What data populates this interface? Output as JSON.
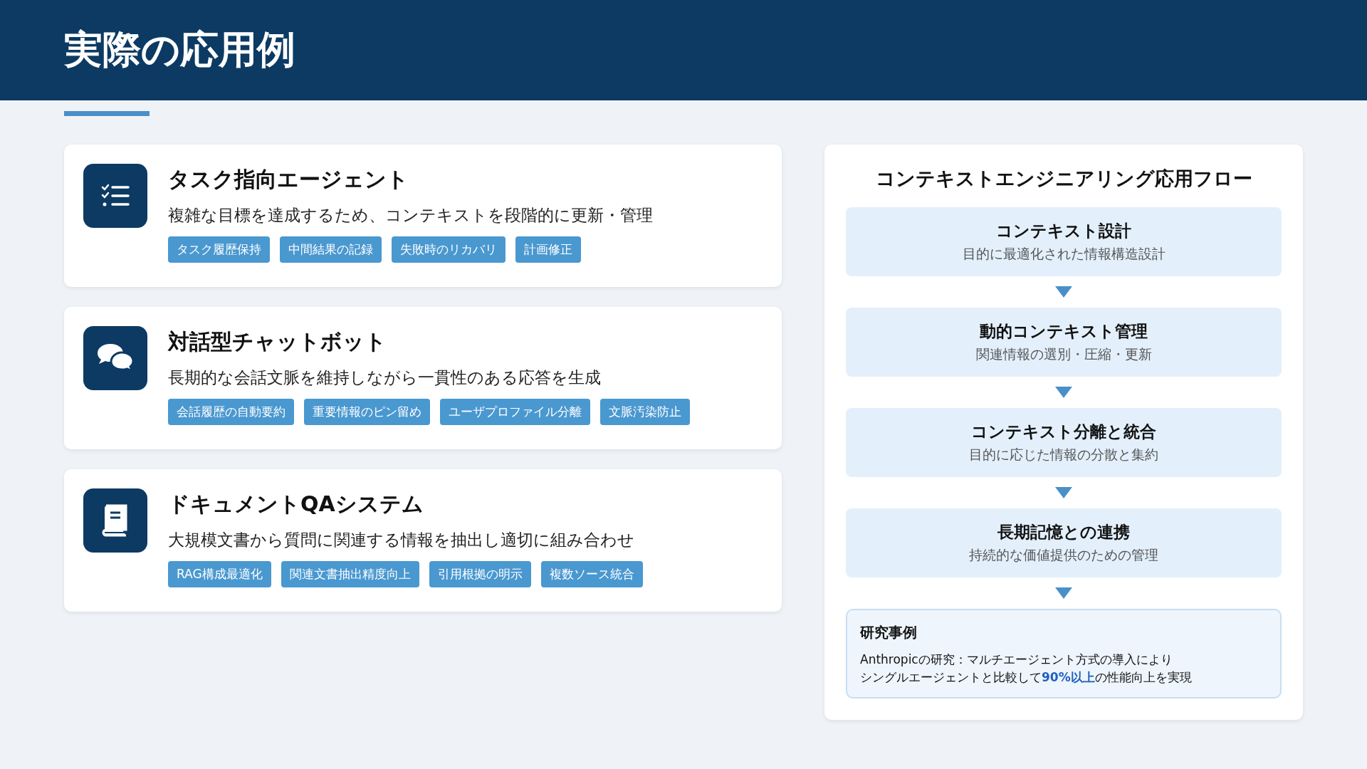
{
  "header": {
    "title": "実際の応用例"
  },
  "cards": [
    {
      "kind": "checklist",
      "title": "タスク指向エージェント",
      "description": "複雑な目標を達成するため、コンテキストを段階的に更新・管理",
      "tags": [
        "タスク履歴保持",
        "中間結果の記録",
        "失敗時のリカバリ",
        "計画修正"
      ]
    },
    {
      "kind": "chat",
      "title": "対話型チャットボット",
      "description": "長期的な会話文脈を維持しながら一貫性のある応答を生成",
      "tags": [
        "会話履歴の自動要約",
        "重要情報のピン留め",
        "ユーザプロファイル分離",
        "文脈汚染防止"
      ]
    },
    {
      "kind": "book",
      "title": "ドキュメントQAシステム",
      "description": "大規模文書から質問に関連する情報を抽出し適切に組み合わせ",
      "tags": [
        "RAG構成最適化",
        "関連文書抽出精度向上",
        "引用根拠の明示",
        "複数ソース統合"
      ]
    }
  ],
  "flow": {
    "title": "コンテキストエンジニアリング応用フロー",
    "steps": [
      {
        "title": "コンテキスト設計",
        "subtitle": "目的に最適化された情報構造設計"
      },
      {
        "title": "動的コンテキスト管理",
        "subtitle": "関連情報の選別・圧縮・更新"
      },
      {
        "title": "コンテキスト分離と統合",
        "subtitle": "目的に応じた情報の分散と集約"
      },
      {
        "title": "長期記憶との連携",
        "subtitle": "持続的な価値提供のための管理"
      }
    ],
    "case": {
      "title": "研究事例",
      "lines": [
        "Anthropicの研究：マルチエージェント方式の導入により",
        "シングルエージェントと比較して**90%以上**の性能向上を実現"
      ]
    }
  }
}
